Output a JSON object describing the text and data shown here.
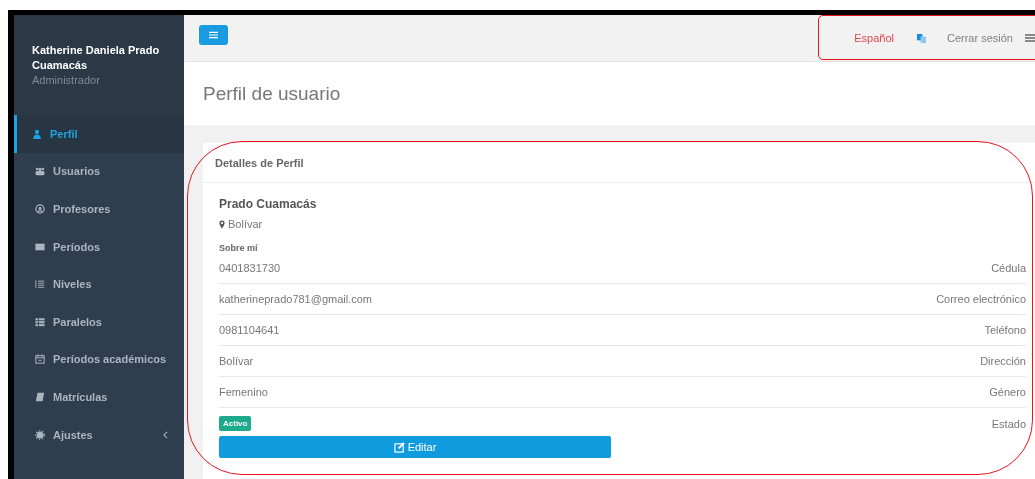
{
  "sidebar": {
    "user": {
      "name": "Katherine Daniela Prado Cuamacás",
      "role": "Administrador"
    },
    "items": [
      {
        "label": "Perfil",
        "selected": true,
        "has_submenu": false
      },
      {
        "label": "Usuarios",
        "selected": false,
        "has_submenu": false
      },
      {
        "label": "Profesores",
        "selected": false,
        "has_submenu": false
      },
      {
        "label": "Períodos",
        "selected": false,
        "has_submenu": false
      },
      {
        "label": "Niveles",
        "selected": false,
        "has_submenu": false
      },
      {
        "label": "Paralelos",
        "selected": false,
        "has_submenu": false
      },
      {
        "label": "Períodos académicos",
        "selected": false,
        "has_submenu": false
      },
      {
        "label": "Matrículas",
        "selected": false,
        "has_submenu": false
      },
      {
        "label": "Ajustes",
        "selected": false,
        "has_submenu": true
      }
    ]
  },
  "topbar": {
    "language": "Español",
    "logout": "Cerrar sesión"
  },
  "page_title": "Perfil de usuario",
  "card": {
    "title": "Detalles de Perfil",
    "name": "Prado Cuamacás",
    "location": "Bolívar",
    "about_label": "Sobre mí",
    "details": [
      {
        "kind": "text",
        "value": "0401831730",
        "label": "Cédula"
      },
      {
        "kind": "text",
        "value": "katherineprado781@gmail.com",
        "label": "Correo electrónico"
      },
      {
        "kind": "text",
        "value": "0981104641",
        "label": "Teléfono"
      },
      {
        "kind": "text",
        "value": "Bolívar",
        "label": "Dirección"
      },
      {
        "kind": "text",
        "value": "Femenino",
        "label": "Género"
      },
      {
        "kind": "badge",
        "value": "Activo",
        "label": "Estado"
      }
    ],
    "edit_button": "Editar"
  }
}
